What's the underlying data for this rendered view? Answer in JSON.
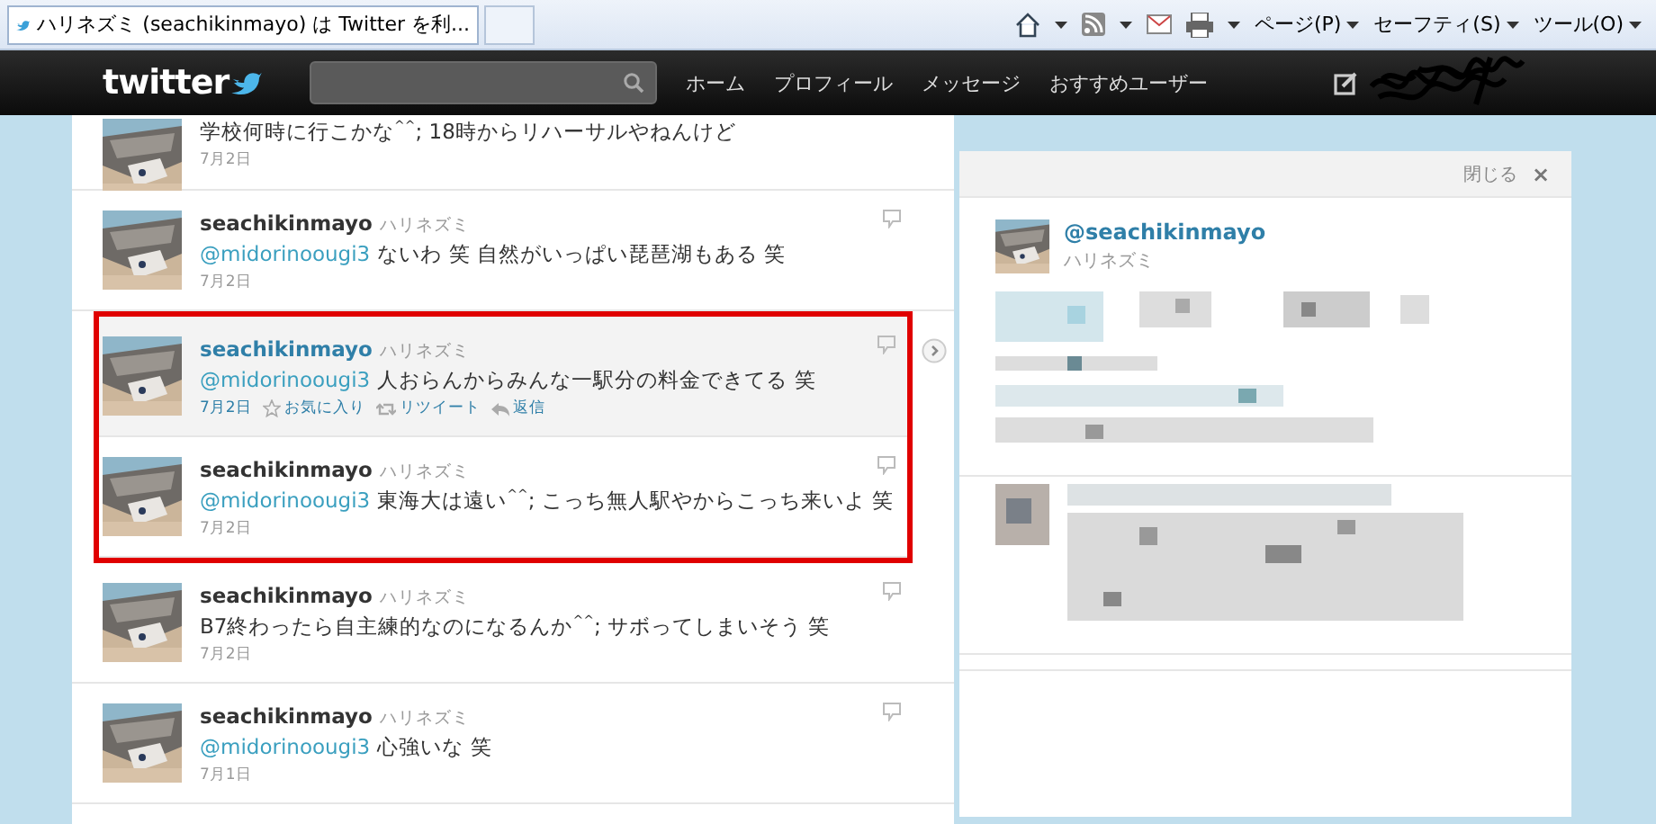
{
  "browser": {
    "tab_title": "ハリネズミ (seachikinmayo) は Twitter を利...",
    "menus": [
      "ページ(P)",
      "セーフティ(S)",
      "ツール(O)"
    ]
  },
  "nav": {
    "logo": "twitter",
    "links": [
      "ホーム",
      "プロフィール",
      "メッセージ",
      "おすすめユーザー"
    ]
  },
  "tweets": [
    {
      "text": "学校何時に行こかな$^{^^}$; 18時からリハーサルやねんけど",
      "date": "7月2日",
      "selected": false,
      "highlighted": false
    },
    {
      "name": "seachikinmayo",
      "fullname": "ハリネズミ",
      "mention": "@midorinoougi3",
      "text": "ないわ 笑 自然がいっぱい琵琶湖もある 笑",
      "date": "7月2日",
      "selected": false,
      "highlighted": false
    },
    {
      "name": "seachikinmayo",
      "fullname": "ハリネズミ",
      "mention": "@midorinoougi3",
      "text": "人おらんからみんな一駅分の料金できてる 笑",
      "date": "7月2日",
      "selected": true,
      "highlighted": true,
      "actions": [
        "お気に入り",
        "リツイート",
        "返信"
      ]
    },
    {
      "name": "seachikinmayo",
      "fullname": "ハリネズミ",
      "mention": "@midorinoougi3",
      "text": "東海大は遠い$^{^^}$; こっち無人駅やからこっち来いよ 笑",
      "date": "7月2日",
      "selected": false,
      "highlighted": true
    },
    {
      "name": "seachikinmayo",
      "fullname": "ハリネズミ",
      "text": "B7終わったら自主練的なのになるんか$^{^^}$; サボってしまいそう 笑",
      "date": "7月2日",
      "selected": false,
      "highlighted": false
    },
    {
      "name": "seachikinmayo",
      "fullname": "ハリネズミ",
      "mention": "@midorinoougi3",
      "text": "心強いな 笑",
      "date": "7月1日",
      "selected": false,
      "highlighted": false
    }
  ],
  "details": {
    "close_label": "閉じる",
    "close_icon": "×",
    "handle": "@seachikinmayo",
    "fullname": "ハリネズミ"
  }
}
